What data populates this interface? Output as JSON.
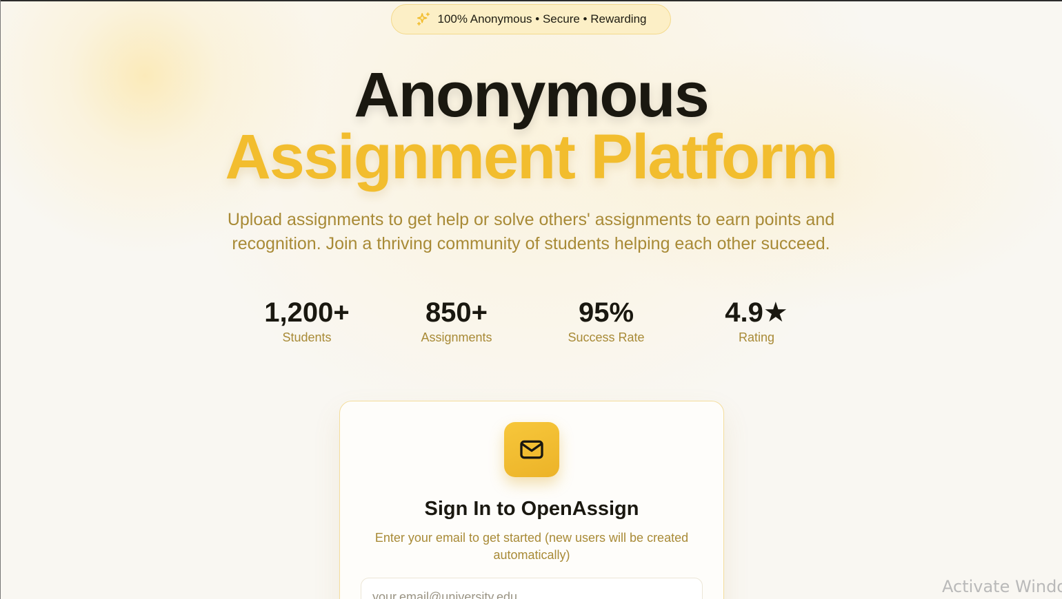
{
  "badge": {
    "icon": "sparkles-icon",
    "text": "100% Anonymous • Secure • Rewarding"
  },
  "hero": {
    "title_line1": "Anonymous",
    "title_line2": "Assignment Platform",
    "subtitle": "Upload assignments to get help or solve others' assignments to earn points and recognition. Join a thriving community of students helping each other succeed."
  },
  "stats": [
    {
      "value": "1,200+",
      "label": "Students"
    },
    {
      "value": "850+",
      "label": "Assignments"
    },
    {
      "value": "95%",
      "label": "Success Rate"
    },
    {
      "value": "4.9★",
      "label": "Rating"
    }
  ],
  "signin": {
    "icon": "mail-icon",
    "title": "Sign In to OpenAssign",
    "description": "Enter your email to get started (new users will be created automatically)",
    "email_placeholder": "your.email@university.edu",
    "email_value": ""
  },
  "os_watermark": "Activate Windows",
  "colors": {
    "accent": "#f2bd2e",
    "muted_text": "#a88a36",
    "background": "#f9f7f2"
  }
}
